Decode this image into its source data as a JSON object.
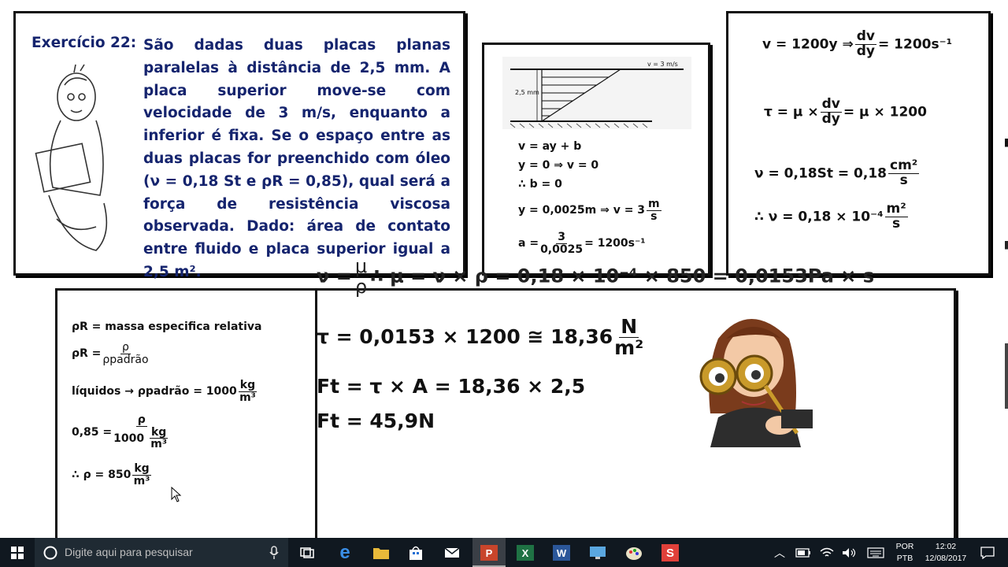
{
  "exercise": {
    "label": "Exercício 22",
    "colon": ":",
    "text": "São dadas duas placas planas paralelas à distância de 2,5 mm. A placa superior move-se com velocidade de 3 m/s, enquanto a inferior é fixa. Se o espaço entre as duas placas for preenchido com óleo (ν = 0,18 St e ρR = 0,85), qual será a força de resistência viscosa observada. Dado: área de contato entre fluido e placa superior igual a 2,5 m²."
  },
  "diagram": {
    "velocity_label": "v = 3 m/s",
    "gap_label": "2,5 mm"
  },
  "middle_box": {
    "l1": "v = ay + b",
    "l2": "y = 0 ⇒ v = 0",
    "l3": "∴ b = 0",
    "l4_left": "y = 0,0025m ⇒ v = 3",
    "l4_num": "m",
    "l4_den": "s",
    "l5_left": "a =",
    "l5_num": "3",
    "l5_den": "0,0025",
    "l5_right": "= 1200s⁻¹"
  },
  "right_box": {
    "r1_left": "v = 1200y ⇒",
    "r1_num": "dv",
    "r1_den": "dy",
    "r1_right": "= 1200s⁻¹",
    "r2_left": "τ = μ ×",
    "r2_num": "dv",
    "r2_den": "dy",
    "r2_right": "= μ × 1200",
    "r3_left": "ν = 0,18St = 0,18",
    "r3_num": "cm²",
    "r3_den": "s",
    "r4_left": "∴ ν = 0,18 × 10⁻⁴",
    "r4_num": "m²",
    "r4_den": "s"
  },
  "overlap_line": {
    "left": "ν =",
    "num": "μ",
    "den": "ρ",
    "right": "∴ μ = ν × ρ = 0,18 × 10⁻⁴ × 850 = 0,0153Pa × s"
  },
  "left_box": {
    "b1": "ρR = massa  especifica  relativa",
    "b2_left": "ρR =",
    "b2_num": "ρ",
    "b2_den": "ρpadrão",
    "b3": "líquidos  → ρpadrão = 1000",
    "b3_num": "kg",
    "b3_den": "m³",
    "b4_left": "0,85 =",
    "b4_num": "ρ",
    "b4_den_a": "1000",
    "b4_den_num": "kg",
    "b4_den_den": "m³",
    "b5": "∴ ρ = 850",
    "b5_num": "kg",
    "b5_den": "m³"
  },
  "bottom_box": {
    "t1_left": "τ = 0,0153 × 1200 ≅ 18,36",
    "t1_num": "N",
    "t1_den": "m²",
    "t2": "Ft = τ × A = 18,36 × 2,5",
    "t3": "Ft = 45,9N"
  },
  "taskbar": {
    "search_placeholder": "Digite aqui para pesquisar",
    "lang1": "POR",
    "lang2": "PTB",
    "time": "12:02",
    "date": "12/08/2017"
  }
}
